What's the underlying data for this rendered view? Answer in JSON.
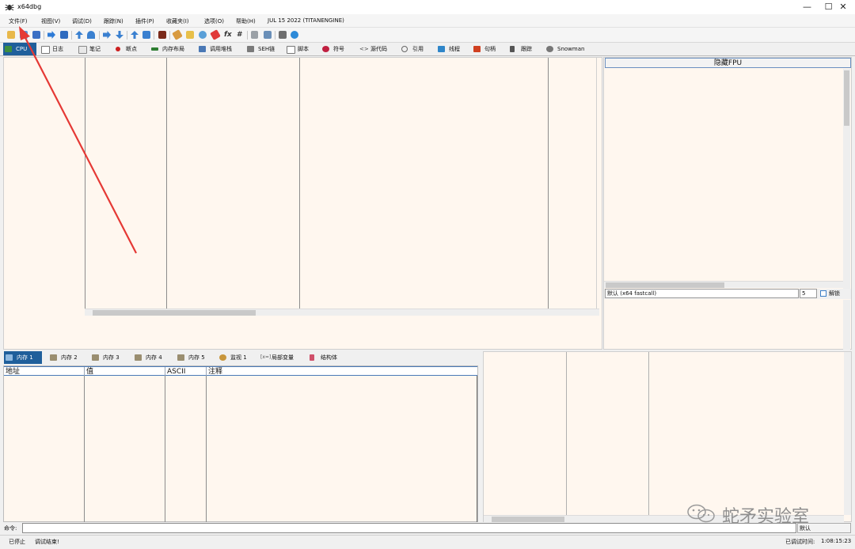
{
  "window": {
    "title": "x64dbg",
    "controls": {
      "minimize": "—",
      "maximize": "☐",
      "close": "✕"
    }
  },
  "menubar": {
    "items": [
      "文件(F)",
      "视图(V)",
      "调试(D)",
      "跟踪(N)",
      "插件(P)",
      "收藏夹(I)",
      "选项(O)",
      "帮助(H)",
      "JUL 15 2022 (TITANENGINE)"
    ]
  },
  "toolbar": {
    "fx_label": "fx",
    "hash_label": "#",
    "icons": [
      "open-icon",
      "restart-icon",
      "close-debug-icon",
      "run-icon",
      "stop-icon",
      "step-into-icon",
      "step-over-icon",
      "trace-into-icon",
      "trace-over-icon",
      "execute-till-return-icon",
      "skip-icon",
      "animate-icon",
      "scylla-icon",
      "patch-icon",
      "comment-icon",
      "label-icon",
      "bookmark-icon",
      "fx-icon",
      "hash-icon",
      "font-icon",
      "calculator-icon",
      "notes-icon",
      "help-icon"
    ]
  },
  "tabs": [
    {
      "label": "CPU",
      "active": true,
      "color": "#3e8e3e"
    },
    {
      "label": "日志",
      "color": "#ffffff"
    },
    {
      "label": "笔记",
      "color": "#e8e8e8"
    },
    {
      "label": "断点",
      "color": "#cc1f1f"
    },
    {
      "label": "内存布局",
      "color": "#2e7d32"
    },
    {
      "label": "调用堆栈",
      "color": "#4a78b5"
    },
    {
      "label": "SEH链",
      "color": "#7a7a7a"
    },
    {
      "label": "脚本",
      "color": "#7a7a7a"
    },
    {
      "label": "符号",
      "color": "#c02040"
    },
    {
      "label": "源代码",
      "color": "#444444"
    },
    {
      "label": "引用",
      "color": "#666666"
    },
    {
      "label": "线程",
      "color": "#2f86c9"
    },
    {
      "label": "句柄",
      "color": "#d04020"
    },
    {
      "label": "跟踪",
      "color": "#555555"
    },
    {
      "label": "Snowman",
      "color": "#777777"
    }
  ],
  "registers": {
    "hide_fpu": "隐藏FPU",
    "calling_convention": "默认 (x64 fastcall)",
    "arg_count": "5",
    "unlock_label": "解锁"
  },
  "dump_tabs": [
    {
      "label": "内存 1",
      "active": true
    },
    {
      "label": "内存 2"
    },
    {
      "label": "内存 3"
    },
    {
      "label": "内存 4"
    },
    {
      "label": "内存 5"
    },
    {
      "label": "监视 1"
    },
    {
      "label": "局部变量"
    },
    {
      "label": "结构体"
    }
  ],
  "dump_columns": [
    "地址",
    "值",
    "ASCII",
    "注释"
  ],
  "command": {
    "label": "命令:",
    "value": "",
    "dropdown": "默认"
  },
  "status": {
    "state": "已停止",
    "message": "调试结束!",
    "time_label": "已调试时间:",
    "time_value": "1:08:15:23"
  },
  "watermark": {
    "text": "蛇矛实验室"
  },
  "colors": {
    "pane_bg": "#fff7ef",
    "accent": "#1f5f9b",
    "annotation_arrow": "#e53935"
  }
}
